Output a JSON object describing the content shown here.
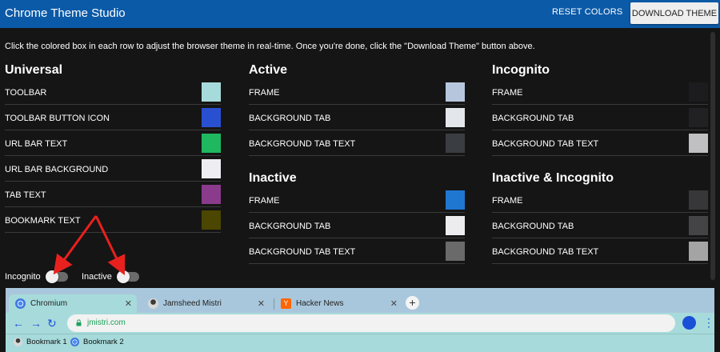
{
  "header": {
    "title": "Chrome Theme Studio",
    "reset_label": "RESET COLORS",
    "download_label": "DOWNLOAD THEME"
  },
  "instructions": "Click the colored box in each row to adjust the browser theme in real-time. Once you're done, click the \"Download Theme\" button above.",
  "universal": {
    "heading": "Universal",
    "rows": [
      {
        "label": "TOOLBAR",
        "color": "#a7dbdb"
      },
      {
        "label": "TOOLBAR BUTTON ICON",
        "color": "#2a50d2"
      },
      {
        "label": "URL BAR TEXT",
        "color": "#1fb860"
      },
      {
        "label": "URL BAR BACKGROUND",
        "color": "#eeeef2"
      },
      {
        "label": "TAB TEXT",
        "color": "#8b3b8c"
      },
      {
        "label": "BOOKMARK TEXT",
        "color": "#4b4600"
      }
    ]
  },
  "active": {
    "heading": "Active",
    "rows": [
      {
        "label": "FRAME",
        "color": "#b6c7dd"
      },
      {
        "label": "BACKGROUND TAB",
        "color": "#e3e6ea"
      },
      {
        "label": "BACKGROUND TAB TEXT",
        "color": "#3a3d41"
      }
    ]
  },
  "inactive": {
    "heading": "Inactive",
    "rows": [
      {
        "label": "FRAME",
        "color": "#1f77d2"
      },
      {
        "label": "BACKGROUND TAB",
        "color": "#ececee"
      },
      {
        "label": "BACKGROUND TAB TEXT",
        "color": "#6a6a6a"
      }
    ]
  },
  "incognito": {
    "heading": "Incognito",
    "rows": [
      {
        "label": "FRAME",
        "color": "#1c1c1e"
      },
      {
        "label": "BACKGROUND TAB",
        "color": "#212124"
      },
      {
        "label": "BACKGROUND TAB TEXT",
        "color": "#c0c0c2"
      }
    ]
  },
  "inactive_incognito": {
    "heading": "Inactive & Incognito",
    "rows": [
      {
        "label": "FRAME",
        "color": "#37373a"
      },
      {
        "label": "BACKGROUND TAB",
        "color": "#444446"
      },
      {
        "label": "BACKGROUND TAB TEXT",
        "color": "#a4a4a4"
      }
    ]
  },
  "toggles": {
    "incognito_label": "Incognito",
    "incognito_on": false,
    "inactive_label": "Inactive",
    "inactive_on": false
  },
  "preview": {
    "tabs": [
      {
        "title": "Chromium",
        "icon": "chromium-icon"
      },
      {
        "title": "Jamsheed Mistri",
        "icon": "avatar-icon"
      },
      {
        "title": "Hacker News",
        "icon": "hacker-news-icon"
      }
    ],
    "url": "jmistri.com",
    "bookmarks": [
      "Bookmark 1",
      "Bookmark 2"
    ]
  }
}
